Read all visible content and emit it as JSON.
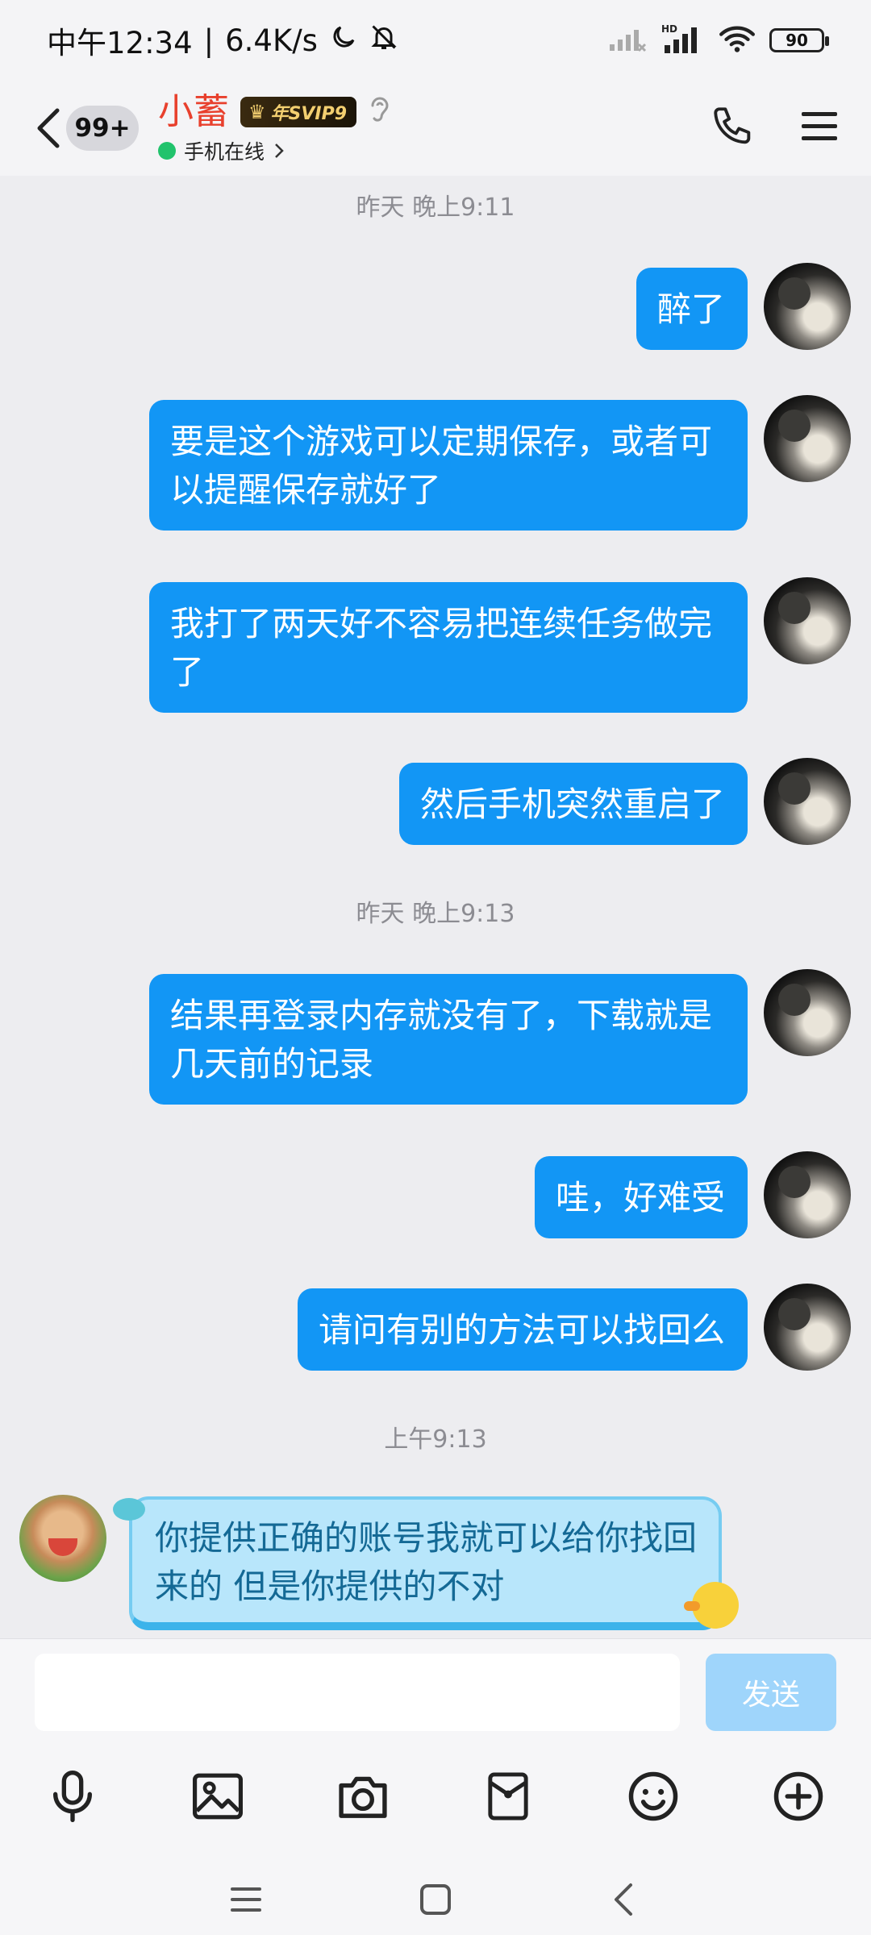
{
  "status_bar": {
    "time": "中午12:34",
    "network_speed": "6.4K/s",
    "battery": "90",
    "icons": [
      "moon-icon",
      "bell-off-icon",
      "signal-weak-icon",
      "hd-signal-icon",
      "wifi-icon",
      "battery-icon"
    ]
  },
  "header": {
    "unread_count": "99+",
    "contact_name": "小蓄",
    "vip_badge": "年SVIP9",
    "online_status": "手机在线"
  },
  "chat": {
    "timestamps": [
      "昨天 晚上9:11",
      "昨天 晚上9:13",
      "上午9:13"
    ],
    "messages": [
      {
        "from": "me",
        "text": "醉了"
      },
      {
        "from": "me",
        "text": "要是这个游戏可以定期保存，或者可以提醒保存就好了"
      },
      {
        "from": "me",
        "text": "我打了两天好不容易把连续任务做完了"
      },
      {
        "from": "me",
        "text": "然后手机突然重启了"
      },
      {
        "from": "me",
        "text": "结果再登录内存就没有了，下载就是几天前的记录"
      },
      {
        "from": "me",
        "text": "哇，好难受"
      },
      {
        "from": "me",
        "text": "请问有别的方法可以找回么"
      },
      {
        "from": "other",
        "text": "你提供正确的账号我就可以给你找回来的 但是你提供的不对"
      }
    ]
  },
  "input": {
    "value": "",
    "placeholder": "",
    "send_label": "发送"
  },
  "toolbar_icons": [
    "microphone-icon",
    "image-icon",
    "camera-icon",
    "red-packet-icon",
    "emoji-icon",
    "plus-icon"
  ],
  "nav_icons": [
    "menu-icon",
    "home-icon",
    "back-icon"
  ],
  "colors": {
    "bubble_out": "#1296f5",
    "bubble_in": "#b8e6fb",
    "contact_name": "#e8402d",
    "online": "#21c36c",
    "send_button": "#9fd5fb"
  }
}
